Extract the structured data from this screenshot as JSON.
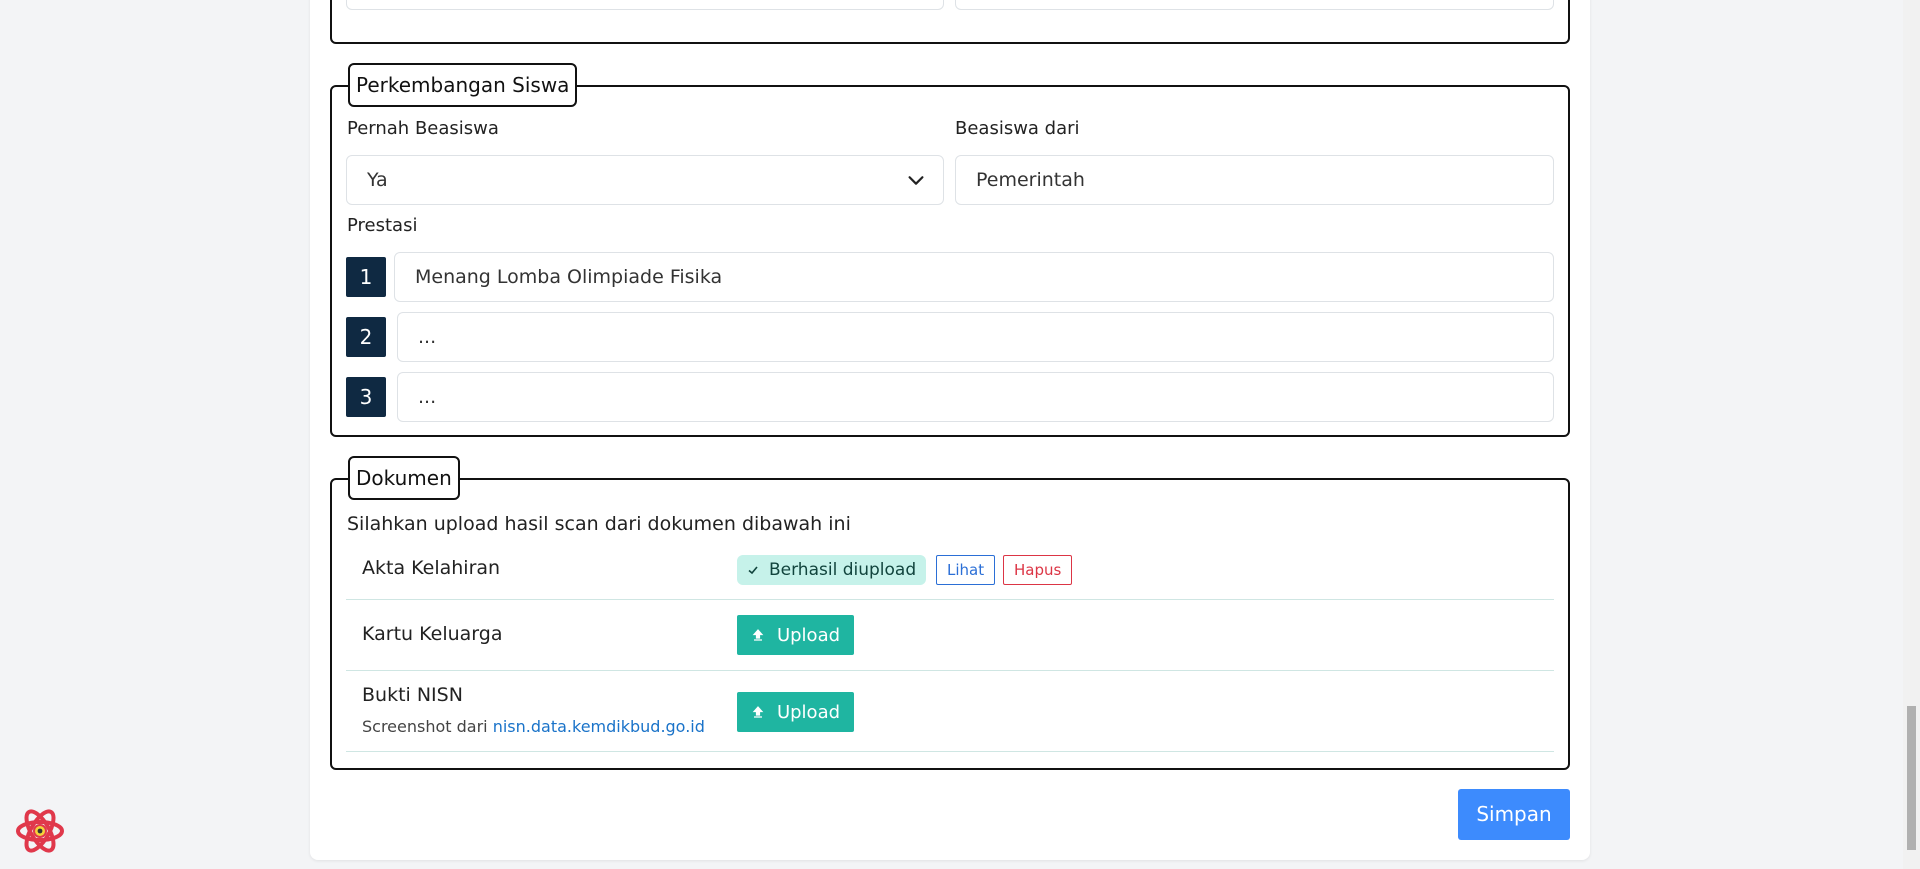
{
  "sections": {
    "perkembangan": {
      "legend": "Perkembangan Siswa",
      "pernah_beasiswa_label": "Pernah Beasiswa",
      "pernah_beasiswa_value": "Ya",
      "beasiswa_dari_label": "Beasiswa dari",
      "beasiswa_dari_value": "Pemerintah",
      "prestasi_label": "Prestasi",
      "prestasi": [
        {
          "num": "1",
          "value": "Menang Lomba Olimpiade Fisika"
        },
        {
          "num": "2",
          "value": "..."
        },
        {
          "num": "3",
          "value": "..."
        }
      ]
    },
    "dokumen": {
      "legend": "Dokumen",
      "instruction": "Silahkan upload hasil scan dari dokumen dibawah ini",
      "items": [
        {
          "label": "Akta Kelahiran",
          "status": "Berhasil diupload",
          "view": "Lihat",
          "delete": "Hapus"
        },
        {
          "label": "Kartu Keluarga",
          "upload": "Upload"
        },
        {
          "label": "Bukti NISN",
          "sub_prefix": "Screenshot dari",
          "sub_link": "nisn.data.kemdikbud.go.id",
          "upload": "Upload"
        }
      ]
    }
  },
  "actions": {
    "save": "Simpan"
  },
  "colors": {
    "primary": "#3d8bfd",
    "teal": "#1fb5a1",
    "navy": "#0f2942",
    "danger": "#dc3545"
  }
}
